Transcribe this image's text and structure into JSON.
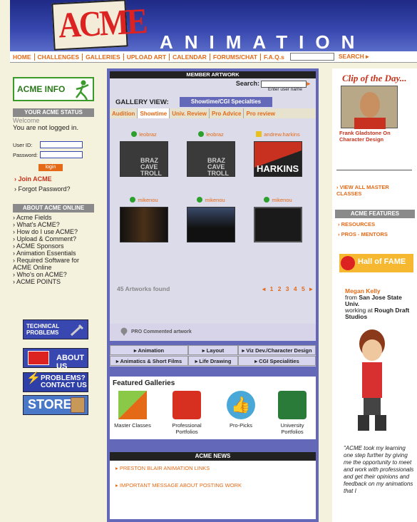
{
  "header": {
    "logo": "ACME",
    "title": "ANIMATION"
  },
  "nav": {
    "items": [
      "HOME",
      "CHALLENGES",
      "GALLERIES",
      "UPLOAD ART",
      "CALENDAR",
      "FORUMS/CHAT",
      "F.A.Q.s"
    ],
    "search_label": "SEARCH ▸"
  },
  "left": {
    "acme_info": "ACME INFO",
    "status_header": "YOUR ACME STATUS",
    "welcome": "Welcome",
    "not_logged": "You are not logged in.",
    "userid_label": "User ID:",
    "password_label": "Password:",
    "login_button": "login",
    "join": "Join ACME",
    "forgot": "Forgot Password?",
    "online_header": "ABOUT ACME ONLINE",
    "online_links": [
      "Acme Fields",
      "What's ACME?",
      "How do I use ACME?",
      "Upload & Comment?",
      "ACME Sponsors",
      "Animation Essentials",
      "Required Software for ACME Online",
      "Who's on ACME?",
      "ACME POINTS"
    ],
    "banners": [
      "TECHNICAL PROBLEMS",
      "ABOUT US",
      "PROBLEMS? CONTACT US",
      "STORE"
    ]
  },
  "center": {
    "header": "MEMBER ARTWORK",
    "search_label": "Search:",
    "search_hint": "Enter user name",
    "gallery_view": "GALLERY VIEW:",
    "gallery_tab": "Showtime/CGI Specialties",
    "subtabs": [
      "Audition",
      "Showtime",
      "Univ. Review",
      "Pro Advice",
      "Pro review"
    ],
    "artworks": [
      {
        "user": "leobraz",
        "caption": "BRAZ CAVE TROLL"
      },
      {
        "user": "leobraz",
        "caption": "BRAZ CAVE TROLL"
      },
      {
        "user": "andrew.harkins",
        "caption": "HARKINS"
      },
      {
        "user": "mikenou",
        "caption": ""
      },
      {
        "user": "mikenou",
        "caption": ""
      },
      {
        "user": "mikenou",
        "caption": ""
      }
    ],
    "found": "45 Artworks found",
    "pages": "◂ 1 2 3 4 5 ▸",
    "pro_commented": "PRO Commented artwork",
    "categories": [
      "Animation",
      "Layout",
      "Viz Dev./Character Design",
      "Animatics & Short Films",
      "Life Drawing",
      "CGI Specialities"
    ],
    "featured_title": "Featured Galleries",
    "featured": [
      "Master Classes",
      "Professional Portfolios",
      "Pro-Picks",
      "University Portfolios"
    ],
    "news_header": "ACME NEWS",
    "news": [
      "PRESTON BLAIR ANIMATION LINKS",
      "IMPORTANT MESSAGE ABOUT POSTING WORK"
    ]
  },
  "right": {
    "clip_title": "Clip of the Day...",
    "clip_caption": "Frank Gladstone On Character Design",
    "view_all": "VIEW ALL MASTER CLASSES",
    "features_header": "ACME FEATURES",
    "feature_links": [
      "RESOURCES",
      "PROS - MENTORS"
    ],
    "hall_of_fame": "Hall of FAME",
    "member_name": "Megan Kelly",
    "member_from": "from",
    "member_school": "San Jose State Univ.",
    "member_work": "working at",
    "member_studio": "Rough Draft Studios",
    "quote": "\"ACME took my learning one step further by giving me the opportunity to meet and work with professionals and get their opinions and feedback on my animations that I"
  }
}
